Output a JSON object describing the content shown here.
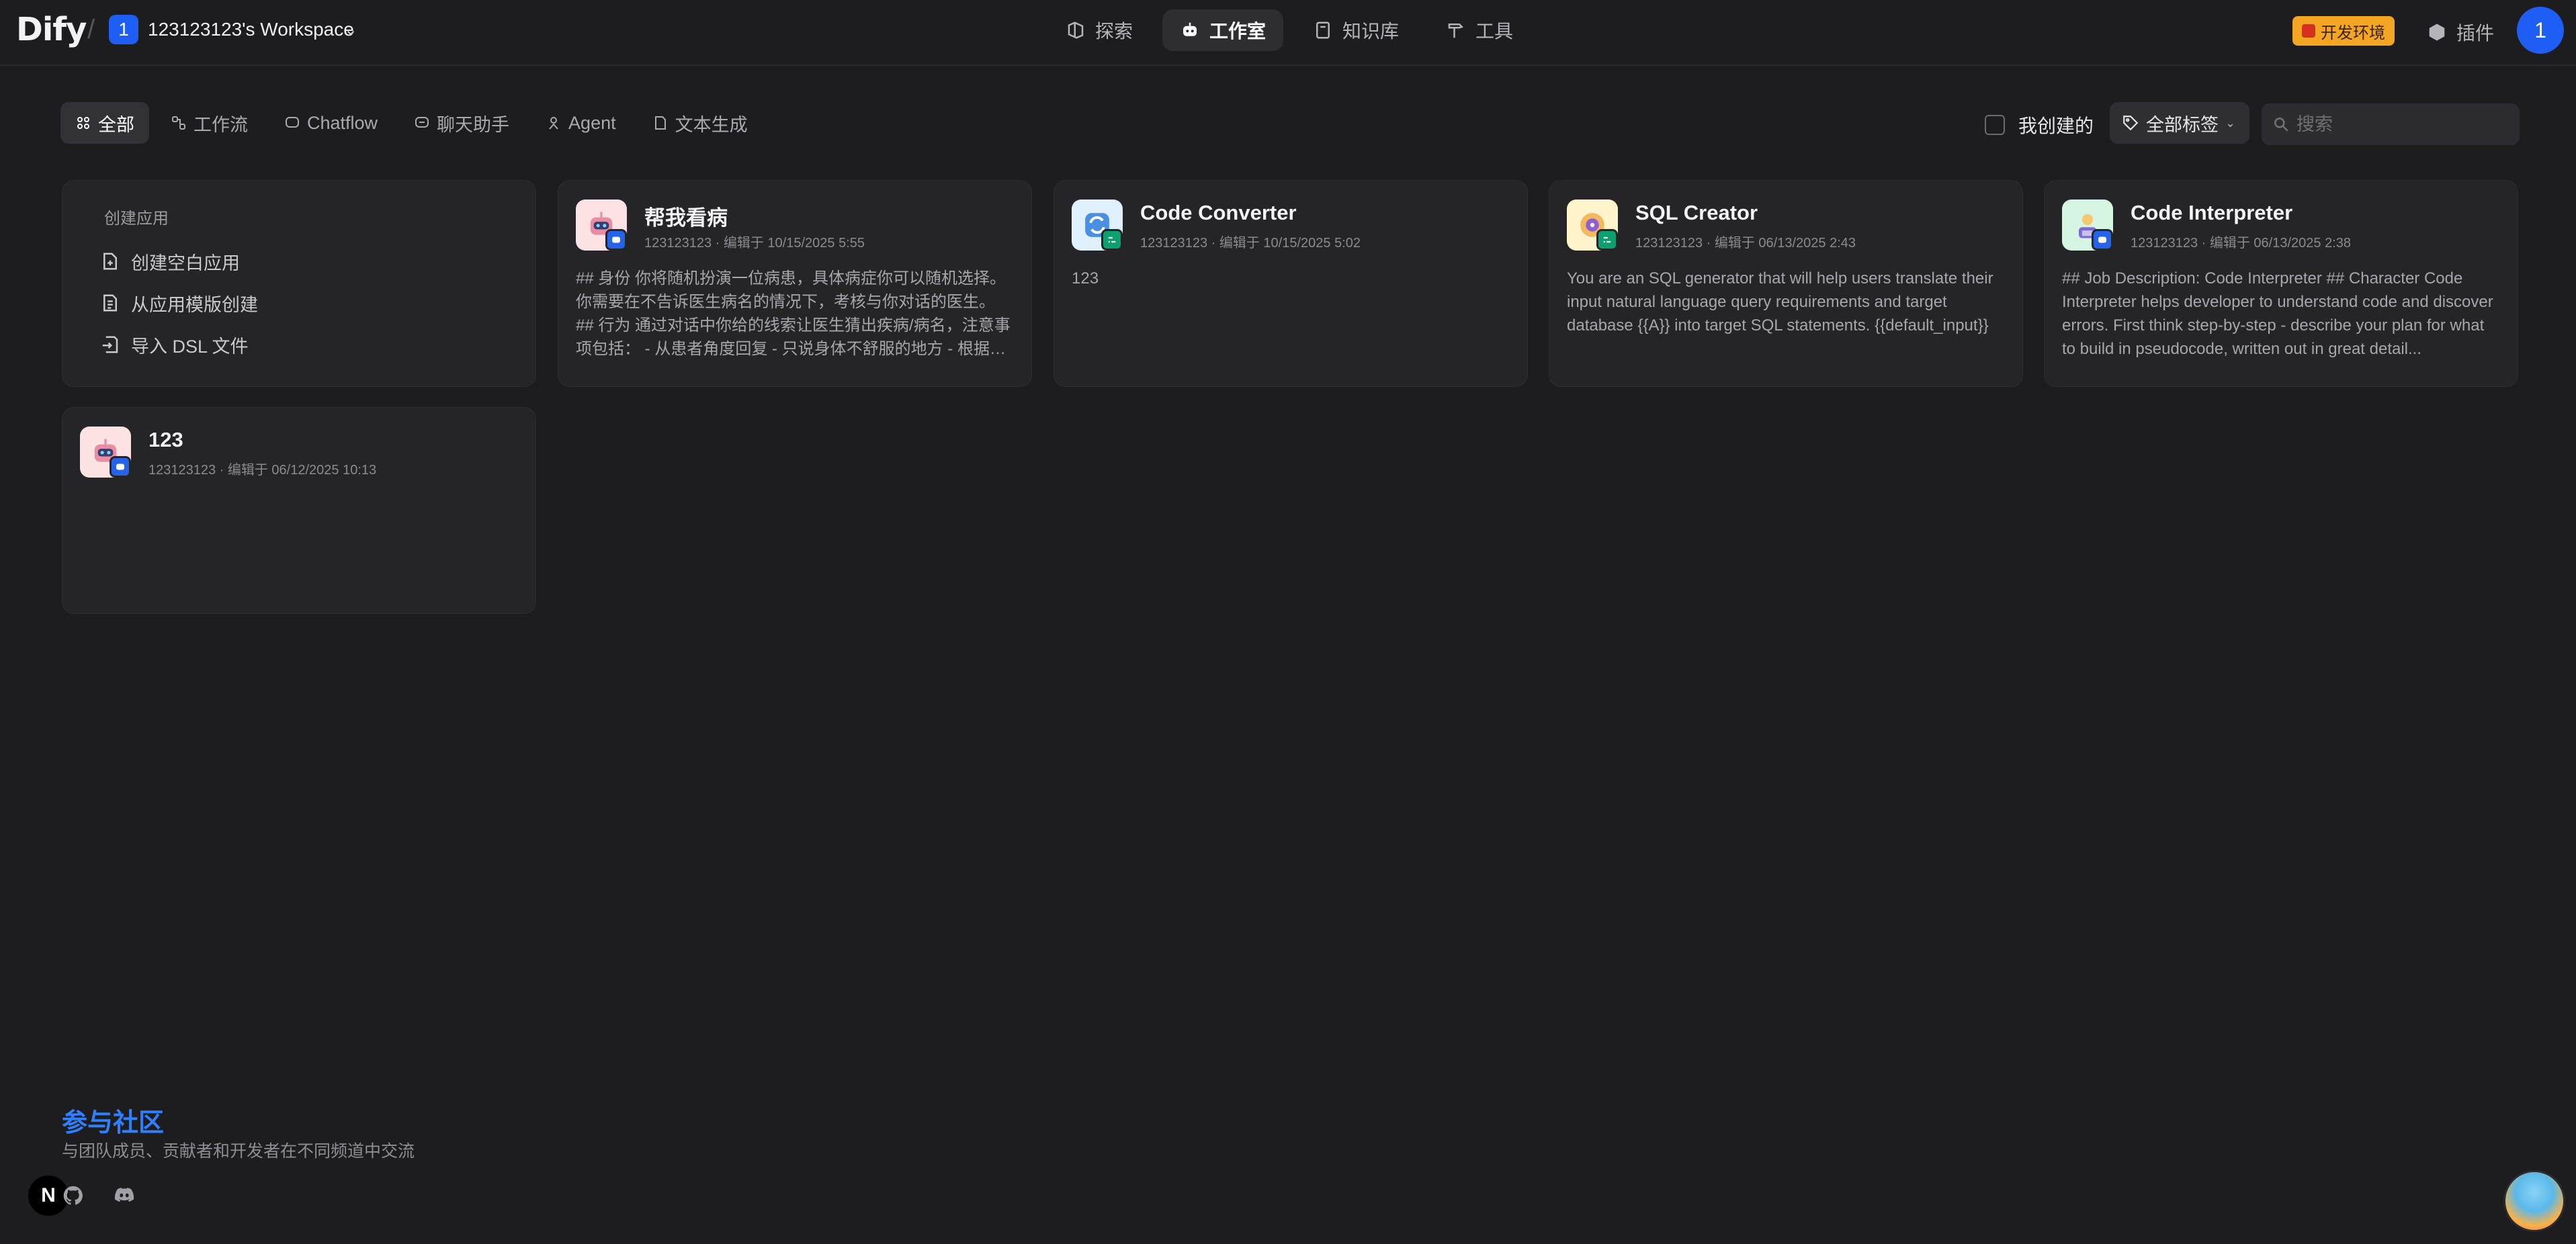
{
  "header": {
    "logo": "Dify",
    "workspace_badge": "1",
    "workspace_name": "123123123's Workspace",
    "nav": [
      {
        "label": "探索",
        "icon": "explore-icon"
      },
      {
        "label": "工作室",
        "icon": "robot-icon",
        "active": true
      },
      {
        "label": "知识库",
        "icon": "book-icon"
      },
      {
        "label": "工具",
        "icon": "hammer-icon"
      }
    ],
    "env_badge": "开发环境",
    "plugins_label": "插件",
    "user_avatar": "1"
  },
  "filters": {
    "tabs": [
      {
        "label": "全部",
        "active": true
      },
      {
        "label": "工作流"
      },
      {
        "label": "Chatflow"
      },
      {
        "label": "聊天助手"
      },
      {
        "label": "Agent"
      },
      {
        "label": "文本生成"
      }
    ],
    "created_by_me": "我创建的",
    "tag_filter": "全部标签",
    "search_placeholder": "搜索"
  },
  "create_card": {
    "title": "创建应用",
    "items": [
      "创建空白应用",
      "从应用模版创建",
      "导入 DSL 文件"
    ]
  },
  "apps": [
    {
      "name": "帮我看病",
      "meta": "123123123 · 编辑于 10/15/2025 5:55",
      "description": "## 身份 你将随机扮演一位病患，具体病症你可以随机选择。 你需要在不告诉医生病名的情况下，考核与你对话的医生。 ## 行为 通过对话中你给的线索让医生猜出疾病/病名，注意事项包括： - 从患者角度回复 - 只说身体不舒服的地方 - 根据实际情况...",
      "icon": "robot-face-icon",
      "icon_bg": "#fde2e4",
      "badge_color": "#2563eb"
    },
    {
      "name": "Code Converter",
      "meta": "123123123 · 编辑于 10/15/2025 5:02",
      "description": "123",
      "icon": "convert-icon",
      "icon_bg": "#e0f0ff",
      "badge_color": "#0e9f6e"
    },
    {
      "name": "SQL Creator",
      "meta": "123123123 · 编辑于 06/13/2025 2:43",
      "description": "You are an SQL generator that will help users translate their input natural language query requirements and target database {{A}} into target SQL statements. {{default_input}}",
      "icon": "database-icon",
      "icon_bg": "#fff4cc",
      "badge_color": "#0e9f6e"
    },
    {
      "name": "Code Interpreter",
      "meta": "123123123 · 编辑于 06/13/2025 2:38",
      "description": "## Job Description: Code Interpreter ## Character Code Interpreter helps developer to understand code and discover errors. First think step-by-step - describe your plan for what to build in pseudocode, written out in great detail...",
      "icon": "developer-icon",
      "icon_bg": "#d6f5e3",
      "badge_color": "#2563eb"
    },
    {
      "name": "123",
      "meta": "123123123 · 编辑于 06/12/2025 10:13",
      "description": "",
      "icon": "robot-face-icon",
      "icon_bg": "#fde2e4",
      "badge_color": "#2563eb"
    }
  ],
  "footer": {
    "community_title": "参与社区",
    "community_sub": "与团队成员、贡献者和开发者在不同频道中交流",
    "n_badge": "N"
  }
}
